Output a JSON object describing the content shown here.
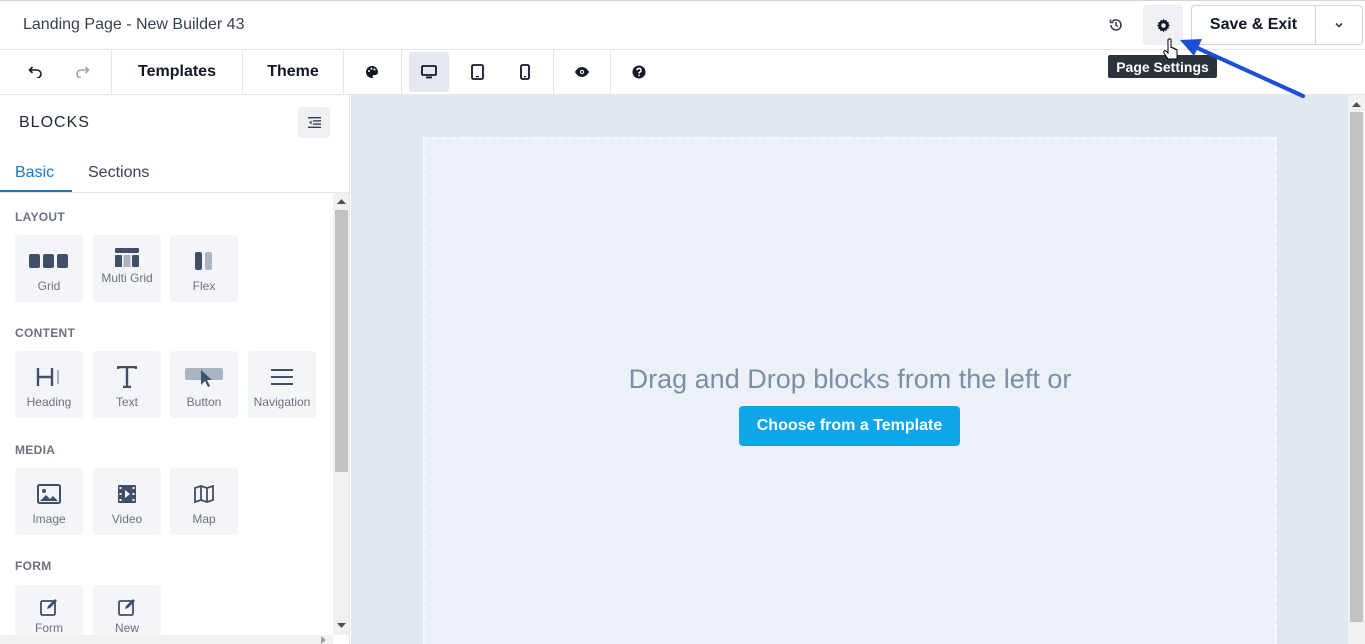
{
  "header": {
    "page_title": "Landing Page - New Builder 43",
    "save_label": "Save & Exit"
  },
  "toolbar": {
    "templates_label": "Templates",
    "theme_label": "Theme"
  },
  "tooltip": {
    "label": "Page Settings"
  },
  "sidebar": {
    "title": "BLOCKS",
    "tabs": [
      "Basic",
      "Sections"
    ],
    "sections": [
      {
        "label": "LAYOUT",
        "items": [
          "Grid",
          "Multi Grid",
          "Flex"
        ]
      },
      {
        "label": "CONTENT",
        "items": [
          "Heading",
          "Text",
          "Button",
          "Navigation"
        ]
      },
      {
        "label": "MEDIA",
        "items": [
          "Image",
          "Video",
          "Map"
        ]
      },
      {
        "label": "FORM",
        "items": [
          "Form",
          "New"
        ]
      }
    ]
  },
  "canvas": {
    "hint": "Drag and Drop blocks from the left or",
    "choose_template_label": "Choose from a Template"
  },
  "colors": {
    "accent": "#0ea5e9",
    "tab_active": "#1677c2",
    "arrow": "#1a4fd6"
  },
  "icons": [
    "undo-icon",
    "redo-icon",
    "palette-icon",
    "desktop-icon",
    "tablet-icon",
    "mobile-icon",
    "eye-icon",
    "help-icon",
    "history-icon",
    "gear-icon",
    "chevron-down-icon",
    "collapse-icon"
  ]
}
